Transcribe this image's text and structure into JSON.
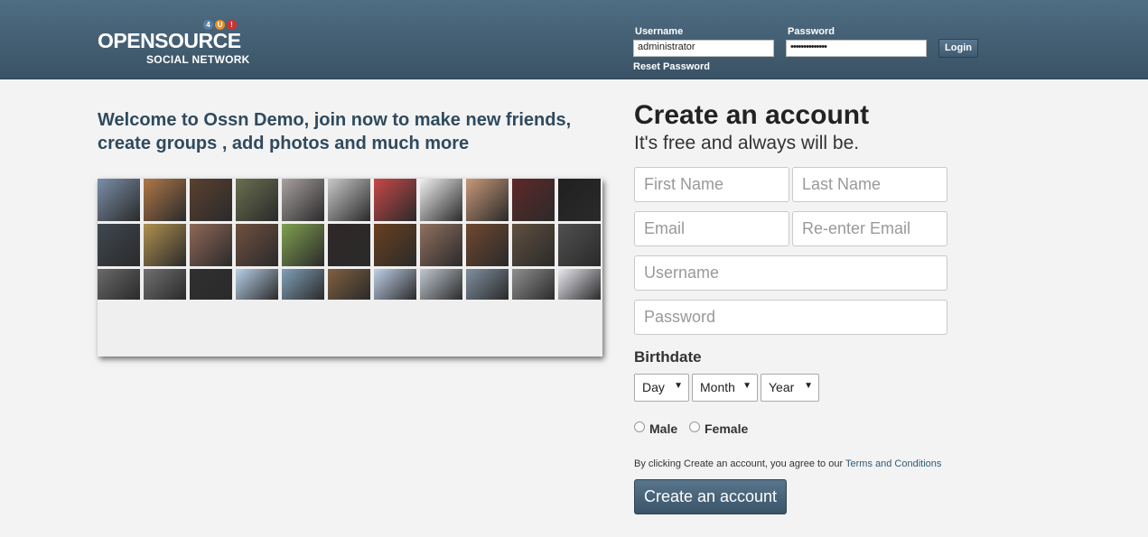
{
  "header": {
    "logo_main": "OPENSOURCE",
    "logo_sub": "SOCIAL NETWORK",
    "logo_badges": [
      "4",
      "U",
      "!"
    ],
    "username_label": "Username",
    "username_value": "administrator",
    "password_label": "Password",
    "password_value": "••••••••••••••",
    "login_button": "Login",
    "reset_password": "Reset Password"
  },
  "welcome_text": "Welcome to Ossn Demo, join now to make new friends, create groups , add photos and much more",
  "photos": {
    "colors": [
      "#7a8fa8",
      "#b07848",
      "#5a4030",
      "#6a7050",
      "#a8a0a0",
      "#c8c8c8",
      "#c84848",
      "#f0f0f0",
      "#c89878",
      "#602828",
      "#202020",
      "#404850",
      "#b09050",
      "#906858",
      "#705040",
      "#80a050",
      "#302828",
      "#6a4020",
      "#907060",
      "#704830",
      "#605040",
      "#505050",
      "#6a6a6a",
      "#707070",
      "#303030",
      "#b8d0e8",
      "#80a0b8",
      "#806040",
      "#c0d0e8",
      "#c0c8d0",
      "#8090a0",
      "#909090",
      "#e8e8f0"
    ]
  },
  "signup": {
    "title": "Create an account",
    "subtitle": "It's free and always will be.",
    "first_name": "First Name",
    "last_name": "Last Name",
    "email": "Email",
    "reenter_email": "Re-enter Email",
    "username": "Username",
    "password": "Password",
    "birthdate_label": "Birthdate",
    "day": "Day",
    "month": "Month",
    "year": "Year",
    "male": "Male",
    "female": "Female",
    "terms_prefix": "By clicking Create an account, you agree to our ",
    "terms_link": "Terms and Conditions",
    "create_button": "Create an account"
  },
  "colors": {
    "header_bg": "#3f596d",
    "accent": "#2f4a5e",
    "badge_colors": [
      "#5a7fa0",
      "#e89020",
      "#d03030"
    ]
  }
}
